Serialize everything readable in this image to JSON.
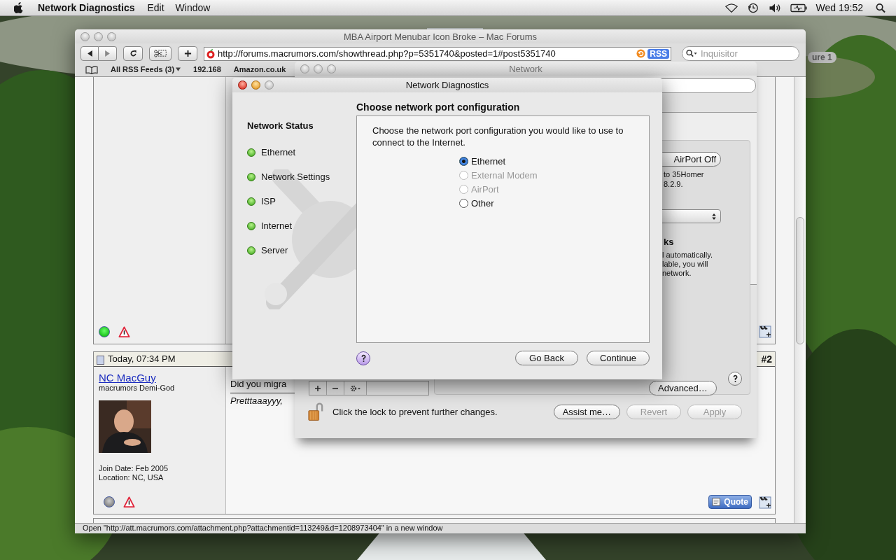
{
  "menubar": {
    "app": "Network Diagnostics",
    "menus": [
      "Edit",
      "Window"
    ],
    "clock": "Wed 19:52"
  },
  "desktop": {
    "label": "ure 1"
  },
  "browser": {
    "title": "MBA Airport Menubar Icon Broke – Mac Forums",
    "url": "http://forums.macrumors.com/showthread.php?p=5351740&posted=1#post5351740",
    "rss": "RSS",
    "search_placeholder": "Inquisitor",
    "bookmarks": [
      {
        "label": "All RSS Feeds (3)",
        "menu": true
      },
      {
        "label": "192.168",
        "menu": false
      },
      {
        "label": "Amazon.co.uk",
        "menu": false
      }
    ],
    "previous_post": {
      "online": true
    },
    "post": {
      "date": "Today, 07:34 PM",
      "number": "#2",
      "user": "NC MacGuy",
      "rank": "macrumors Demi-God",
      "join": "Join Date: Feb 2005",
      "location": "Location: NC, USA",
      "online": false,
      "body": "Did you migra",
      "signature": "Pretttaaayyy,",
      "quote": "Quote"
    },
    "status": "Open \"http://att.macrumors.com/attachment.php?attachmentid=113249&d=1208973404\" in a new window"
  },
  "network": {
    "title": "Network",
    "airport_button": "AirPort Off",
    "status_lines": [
      "to 35Homer",
      "8.2.9."
    ],
    "section_heading": "ks",
    "description_lines": [
      "l automatically.",
      "lable, you will",
      "network."
    ],
    "advanced": "Advanced…",
    "lock_text": "Click the lock to prevent further changes.",
    "buttons": [
      {
        "label": "Assist me…",
        "disabled": false
      },
      {
        "label": "Revert",
        "disabled": true
      },
      {
        "label": "Apply",
        "disabled": true
      }
    ]
  },
  "dialog": {
    "title": "Network Diagnostics",
    "status_heading": "Network Status",
    "checks": [
      {
        "label": "Ethernet",
        "passed": true
      },
      {
        "label": "Network Settings",
        "passed": true
      },
      {
        "label": "ISP",
        "passed": true
      },
      {
        "label": "Internet",
        "passed": true
      },
      {
        "label": "Server",
        "passed": true
      }
    ],
    "heading": "Choose network port configuration",
    "prompt": "Choose the network port configuration you would like to use to connect to the Internet.",
    "options": [
      {
        "label": "Ethernet",
        "selected": true,
        "disabled": false
      },
      {
        "label": "External Modem",
        "selected": false,
        "disabled": true
      },
      {
        "label": "AirPort",
        "selected": false,
        "disabled": true
      },
      {
        "label": "Other",
        "selected": false,
        "disabled": false
      }
    ],
    "buttons": [
      "Go Back",
      "Continue"
    ]
  }
}
